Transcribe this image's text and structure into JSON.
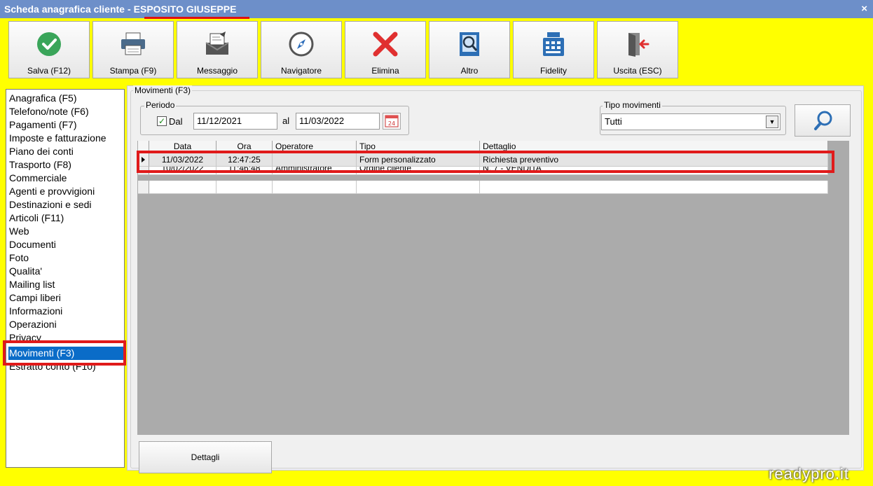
{
  "window": {
    "title": "Scheda anagrafica cliente",
    "separator": "-",
    "customer_name": "ESPOSITO GIUSEPPE",
    "close_glyph": "×"
  },
  "toolbar": {
    "buttons": [
      {
        "label": "Salva (F12)",
        "icon": "check-circle-icon"
      },
      {
        "label": "Stampa (F9)",
        "icon": "printer-icon"
      },
      {
        "label": "Messaggio",
        "icon": "message-icon"
      },
      {
        "label": "Navigatore",
        "icon": "compass-icon"
      },
      {
        "label": "Elimina",
        "icon": "red-x-icon"
      },
      {
        "label": "Altro",
        "icon": "book-search-icon"
      },
      {
        "label": "Fidelity",
        "icon": "cash-register-icon"
      },
      {
        "label": "Uscita (ESC)",
        "icon": "exit-door-icon"
      }
    ]
  },
  "sidebar": {
    "items": [
      {
        "label": "Anagrafica (F5)"
      },
      {
        "label": "Telefono/note (F6)"
      },
      {
        "label": "Pagamenti (F7)"
      },
      {
        "label": "Imposte e fatturazione"
      },
      {
        "label": "Piano dei conti"
      },
      {
        "label": "Trasporto (F8)"
      },
      {
        "label": "Commerciale"
      },
      {
        "label": "Agenti e provvigioni"
      },
      {
        "label": "Destinazioni e sedi"
      },
      {
        "label": "Articoli (F11)"
      },
      {
        "label": "Web"
      },
      {
        "label": "Documenti"
      },
      {
        "label": "Foto"
      },
      {
        "label": "Qualita'"
      },
      {
        "label": "Mailing list"
      },
      {
        "label": "Campi liberi"
      },
      {
        "label": "Informazioni"
      },
      {
        "label": "Operazioni"
      },
      {
        "label": "Privacy"
      },
      {
        "label": "Movimenti (F3)"
      },
      {
        "label": "Estratto conto (F10)"
      }
    ],
    "selected": "Movimenti (F3)"
  },
  "main": {
    "group_title": "Movimenti (F3)",
    "periodo": {
      "label": "Periodo",
      "dal_label": "Dal",
      "dal_checked": true,
      "dal_value": "11/12/2021",
      "al_label": "al",
      "al_value": "11/03/2022",
      "calendar_number": "24"
    },
    "tipo_movimenti": {
      "label": "Tipo movimenti",
      "selected": "Tutti"
    },
    "grid": {
      "columns": [
        "Data",
        "Ora",
        "Operatore",
        "Tipo",
        "Dettaglio"
      ],
      "rows": [
        [
          "11/03/2022",
          "12:47:25",
          "",
          "Form personalizzato",
          "Richiesta preventivo"
        ],
        [
          "10/02/2022",
          "11:46:48",
          "Amministratore",
          "Ordine cliente",
          "N. 7 - VENDITA"
        ]
      ]
    },
    "dettagli_button": "Dettagli"
  },
  "watermark": "readypro.it",
  "colors": {
    "background": "#ffff00",
    "titlebar": "#6d8fc9",
    "highlight": "#e01a1a",
    "selection": "#0a6cc8"
  }
}
